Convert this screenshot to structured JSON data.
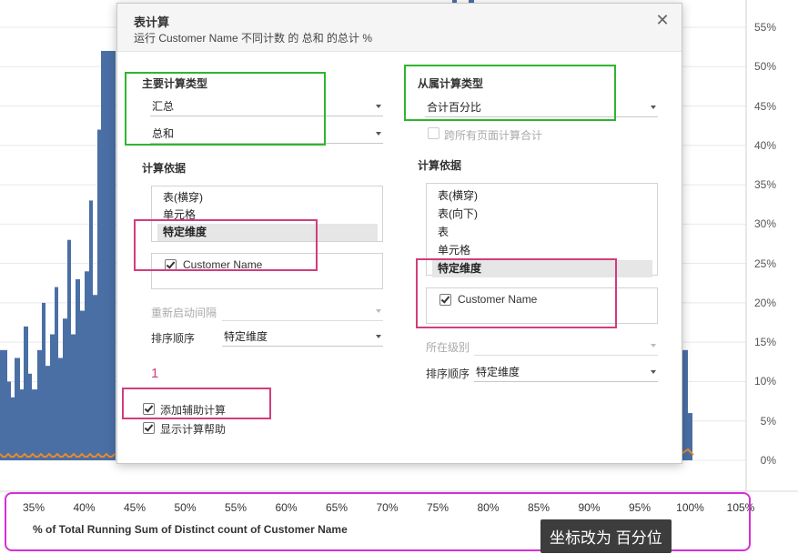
{
  "colors": {
    "bar": "#4a6fa5",
    "running_line": "#e88a2c",
    "gridline": "#e8e8e8",
    "green_highlight": "#2fb52f",
    "pink_highlight": "#d23d7b",
    "magenta_highlight": "#d62fd6"
  },
  "chart_data": {
    "type": "bar",
    "y_tick_labels": [
      "55%",
      "50%",
      "45%",
      "40%",
      "35%",
      "30%",
      "25%",
      "20%",
      "15%",
      "10%",
      "5%",
      "0%"
    ],
    "x_tick_labels": [
      "35%",
      "40%",
      "45%",
      "50%",
      "55%",
      "60%",
      "65%",
      "70%",
      "75%",
      "80%",
      "85%",
      "90%",
      "95%",
      "100%",
      "105%"
    ],
    "xlabel": "% of Total Running Sum of Distinct count of Customer Name",
    "ylim": [
      0,
      57
    ],
    "xlim": [
      32,
      107
    ],
    "grid": true
  },
  "axis_note": "坐标改为 百分位",
  "dialog": {
    "title": "表计算",
    "subtitle": "运行 Customer Name 不同计数 的 总和 的总计 %",
    "close_icon": "close-icon",
    "primary": {
      "heading": "主要计算类型",
      "type_value": "汇总",
      "agg_value": "总和",
      "compute_using_label": "计算依据",
      "compute_items": [
        "表(横穿)",
        "单元格",
        "特定维度"
      ],
      "selected_index": 2,
      "dimension": "Customer Name",
      "restart_label": "重新启动间隔",
      "sort_label": "排序顺序",
      "sort_value": "特定维度"
    },
    "secondary": {
      "heading": "从属计算类型",
      "type_value": "合计百分比",
      "across_pages_label": "跨所有页面计算合计",
      "compute_using_label": "计算依据",
      "compute_items": [
        "表(横穿)",
        "表(向下)",
        "表",
        "单元格",
        "特定维度"
      ],
      "selected_index": 4,
      "dimension": "Customer Name",
      "level_label": "所在级别",
      "sort_label": "排序顺序",
      "sort_value": "特定维度"
    },
    "add_secondary_label": "添加辅助计算",
    "show_help_label": "显示计算帮助",
    "step_number": "1"
  }
}
